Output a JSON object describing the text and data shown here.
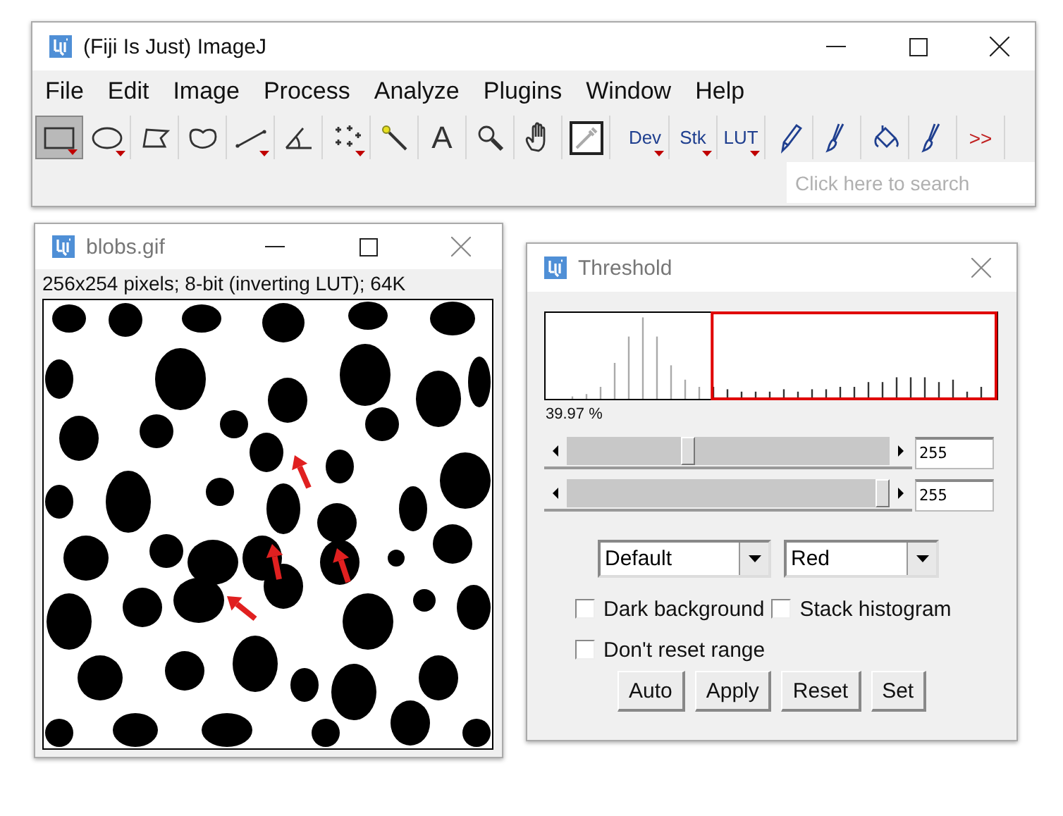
{
  "main_window": {
    "title": "(Fiji Is Just) ImageJ",
    "menu": [
      "File",
      "Edit",
      "Image",
      "Process",
      "Analyze",
      "Plugins",
      "Window",
      "Help"
    ],
    "tools": [
      {
        "kind": "rectangle",
        "selected": true,
        "menu": true
      },
      {
        "kind": "oval",
        "selected": false,
        "menu": true
      },
      {
        "kind": "polygon",
        "selected": false,
        "menu": false
      },
      {
        "kind": "freehand",
        "selected": false,
        "menu": false
      },
      {
        "kind": "line",
        "selected": false,
        "menu": true
      },
      {
        "kind": "angle",
        "selected": false,
        "menu": false
      },
      {
        "kind": "multipoint",
        "selected": false,
        "menu": true
      },
      {
        "kind": "wand",
        "selected": false,
        "menu": false
      },
      {
        "kind": "letter",
        "label": "A",
        "selected": false,
        "menu": false
      },
      {
        "kind": "magnifier",
        "selected": false,
        "menu": false
      },
      {
        "kind": "hand",
        "selected": false,
        "menu": false
      },
      {
        "kind": "dropper",
        "selected": false,
        "menu": false
      },
      {
        "kind": "label",
        "label": "Dev",
        "selected": false,
        "menu": true
      },
      {
        "kind": "label",
        "label": "Stk",
        "selected": false,
        "menu": true
      },
      {
        "kind": "label",
        "label": "LUT",
        "selected": false,
        "menu": true
      },
      {
        "kind": "pencil",
        "selected": false,
        "menu": false
      },
      {
        "kind": "brush",
        "selected": false,
        "menu": false
      },
      {
        "kind": "bucket",
        "selected": false,
        "menu": false
      },
      {
        "kind": "brush",
        "selected": false,
        "menu": false
      },
      {
        "kind": "more",
        "label": ">>",
        "selected": false,
        "menu": false
      }
    ],
    "search": {
      "placeholder": "Click here to search"
    }
  },
  "image_window": {
    "title": "blobs.gif",
    "info": "256x254 pixels; 8-bit (inverting LUT); 64K"
  },
  "threshold": {
    "title": "Threshold",
    "percent": "39.97 %",
    "sliders": [
      {
        "level": 0.37,
        "value": "255"
      },
      {
        "level": 1,
        "value": "255"
      }
    ],
    "dropdowns": [
      "Default",
      "Red"
    ],
    "checkboxes": [
      {
        "label": "Dark background",
        "checked": false
      },
      {
        "label": "Stack histogram",
        "checked": false
      },
      {
        "label": "Don't reset range",
        "checked": false
      }
    ],
    "buttons": [
      "Auto",
      "Apply",
      "Reset",
      "Set"
    ]
  }
}
